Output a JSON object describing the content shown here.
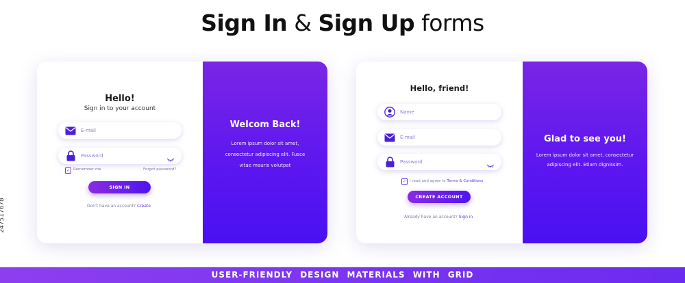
{
  "title": {
    "bold_1": "Sign In",
    "amp": "&",
    "bold_2": "Sign Up",
    "rest": "forms"
  },
  "signin": {
    "heading": "Hello!",
    "subheading": "Sign in to your account",
    "email_placeholder": "E-mail",
    "password_placeholder": "Password",
    "remember_label": "Remember me",
    "forgot_label": "Forgot password?",
    "button_label": "SIGN IN",
    "no_account_text": "Don't have an account?",
    "create_link": "Create",
    "panel_title": "Welcom Back!",
    "panel_text_1": "Lorem ipsum dolor sit amet,",
    "panel_text_2": "consectetur adipiscing elit. Fusce",
    "panel_text_3": "vitae mauris volutpat"
  },
  "signup": {
    "heading": "Hello, friend!",
    "name_placeholder": "Name",
    "email_placeholder": "E-mail",
    "password_placeholder": "Password",
    "agree_text": "I read and agree to",
    "terms_link": "Terms & Conditions",
    "button_label": "CREATE ACCOUNT",
    "already_text": "Already have an account?",
    "signin_link": "Sign in",
    "panel_title": "Glad to see you!",
    "panel_text_1": "Lorem ipsum dolor sit amet, consectetur",
    "panel_text_2": "adipiscing elit. Etiam dignissim."
  },
  "footer_banner": "USER-FRIENDLY DESIGN MATERIALS WITH GRID",
  "stock_id": "247517678",
  "colors": {
    "accent": "#5b16f0",
    "accent_light": "#8a2be2",
    "banner": "#7d35f0"
  },
  "icons": [
    "envelope-icon",
    "lock-icon",
    "eye-closed-icon",
    "user-icon",
    "checkbox-icon"
  ]
}
